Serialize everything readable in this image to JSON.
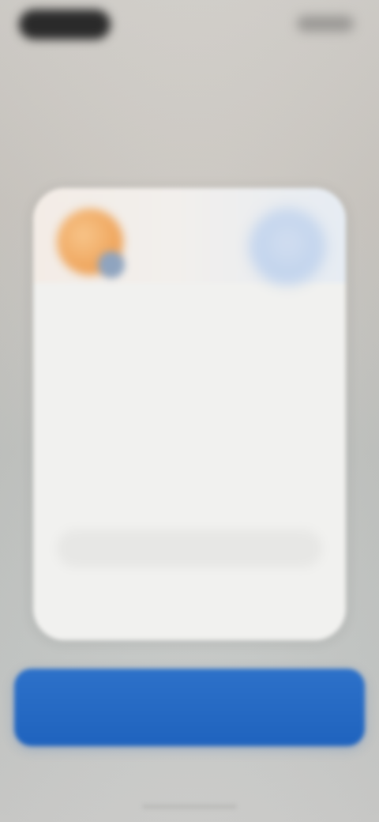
{
  "status_bar": {
    "left_pill": "",
    "right_icons": ""
  },
  "dialog": {
    "title": "",
    "body": "",
    "secondary_button_label": "",
    "dismiss_label": ""
  },
  "primary_button": {
    "label": "",
    "color": "#1f63be"
  },
  "colors": {
    "card_background": "#f1f1ef",
    "avatar_left": "#eea258",
    "avatar_right": "#bfd2ec",
    "primary_accent": "#1f63be"
  },
  "icons": {
    "left_avatar": "profile-avatar-icon",
    "right_avatar": "profile-avatar-icon"
  }
}
